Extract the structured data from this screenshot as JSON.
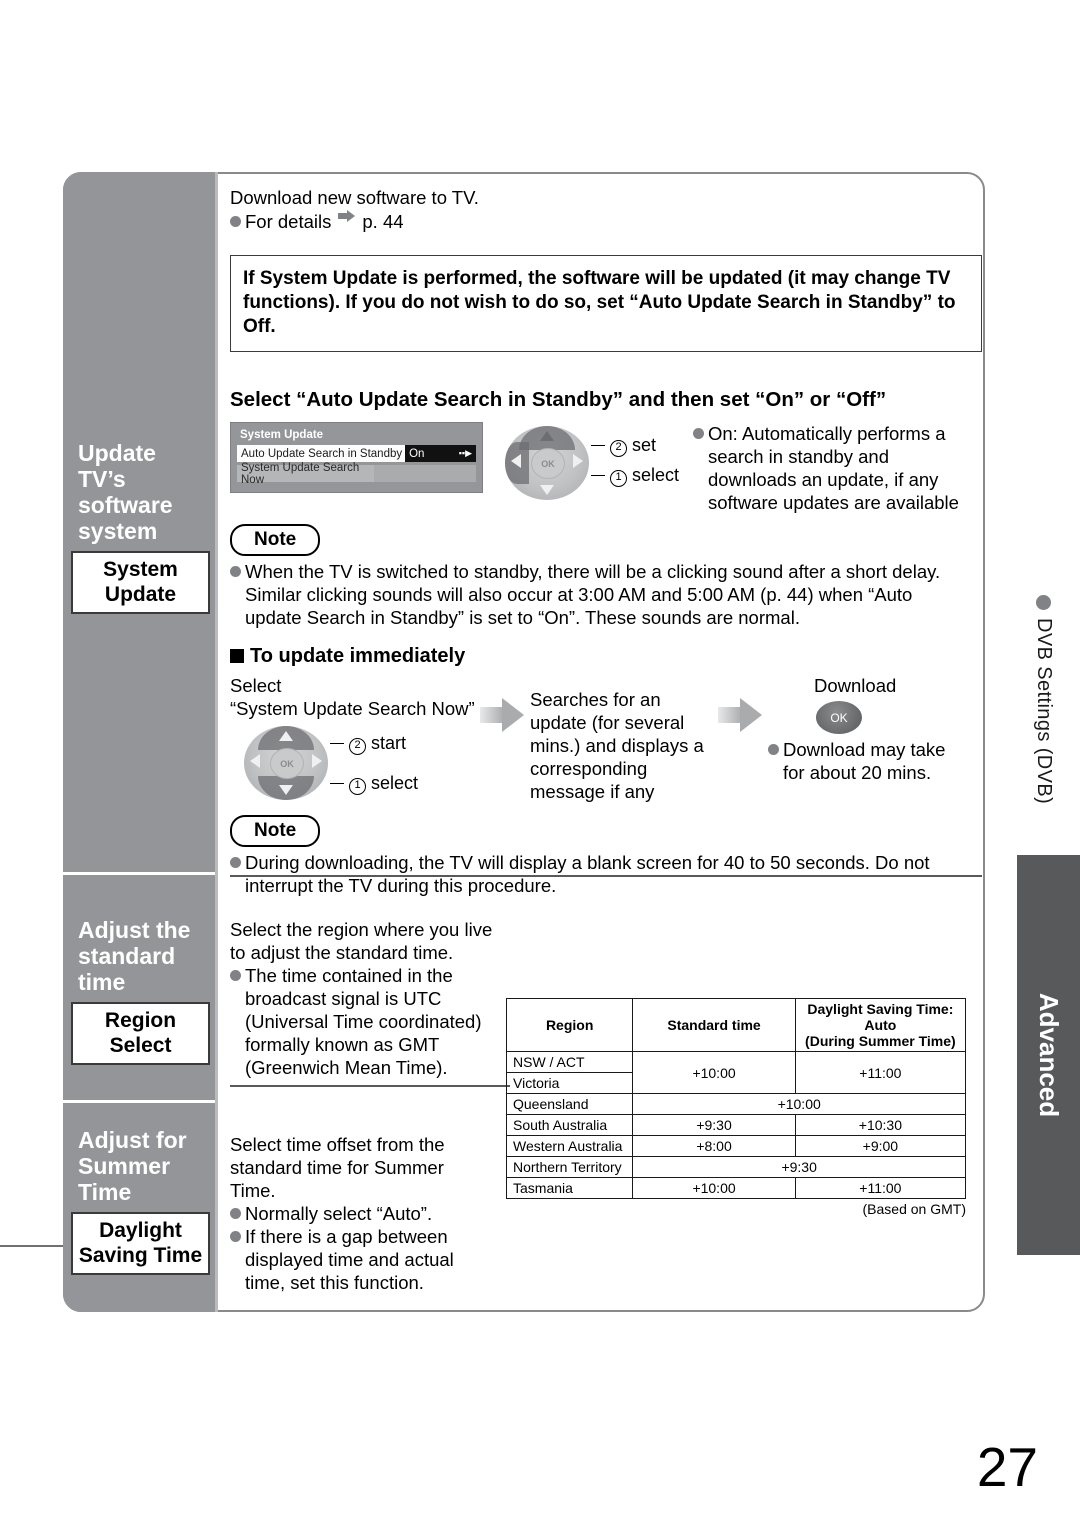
{
  "sidebar": {
    "groups": [
      {
        "heading": "Update\nTV’s\nsoftware\nsystem",
        "heading_line1": "Update",
        "heading_line2": "TV’s",
        "heading_line3": "software",
        "heading_line4": "system",
        "button_line1": "System",
        "button_line2": "Update"
      },
      {
        "heading_line1": "Adjust the",
        "heading_line2": "standard time",
        "button_line1": "Region",
        "button_line2": "Select"
      },
      {
        "heading_line1": "Adjust for",
        "heading_line2": "Summer Time",
        "button_line1": "Daylight",
        "button_line2": "Saving Time"
      }
    ]
  },
  "tabs": {
    "dvb_label": "DVB Settings (DVB)",
    "advanced_label": "Advanced"
  },
  "system_update": {
    "intro_line1": "Download new software to TV.",
    "intro_bullet": "For details",
    "intro_page_ref": "p. 44",
    "warning": "If System Update is performed, the software will be updated (it may change TV functions). If you do not wish to do so, set “Auto Update Search in Standby” to Off.",
    "section_heading": "Select “Auto Update Search in Standby” and then set “On” or “Off”",
    "osd": {
      "title": "System Update",
      "row1_label": "Auto Update Search in Standby",
      "row1_value": "On",
      "row2_label": "System Update Search Now",
      "row2_value": ""
    },
    "dpad1": {
      "step2_num": "②",
      "step2_label": "set",
      "step1_num": "①",
      "step1_label": "select",
      "ok_label": "OK"
    },
    "on_description": "On: Automatically performs a search in standby and downloads an update, if any software updates are available",
    "note1_badge": "Note",
    "note1_text": "When the TV is switched to standby, there will be a clicking sound after a short delay. Similar clicking sounds will also occur at 3:00 AM and 5:00 AM (p. 44) when “Auto update Search in Standby” is set to “On”. These sounds are normal.",
    "immediate_heading": "To update immediately",
    "immediate_select_line1": "Select",
    "immediate_select_line2": "“System Update Search Now”",
    "dpad2": {
      "step2_num": "②",
      "step2_label": "start",
      "step1_num": "①",
      "step1_label": "select",
      "ok_label": "OK"
    },
    "searching_text": "Searches for an update (for several mins.) and displays a corresponding message if any",
    "download_label": "Download",
    "download_ok": "OK",
    "download_note": "Download may take for about 20 mins.",
    "note2_badge": "Note",
    "note2_text": "During downloading, the TV will display a blank screen for 40 to 50 seconds. Do not interrupt the TV during this procedure."
  },
  "region_select": {
    "line1": "Select the region where you live",
    "line2": "to adjust the standard time.",
    "bullet": "The time contained in the broadcast signal is UTC (Universal Time coordinated) formally known as GMT (Greenwich Mean Time)."
  },
  "summer_time": {
    "line1": "Select time offset from the",
    "line2": "standard time for Summer",
    "line3": "Time.",
    "bullet1": "Normally select “Auto”.",
    "bullet2": "If there is a gap between displayed time and actual time, set this function."
  },
  "region_table": {
    "headers": {
      "region": "Region",
      "standard": "Standard time",
      "dst_line1": "Daylight Saving Time: Auto",
      "dst_line2": "(During Summer Time)"
    },
    "rows": [
      {
        "region": "NSW / ACT",
        "standard": "+10:00",
        "dst": "+11:00"
      },
      {
        "region": "Victoria",
        "standard": "+10:00",
        "dst": "+11:00"
      },
      {
        "region": "Queensland",
        "standard": "+10:00",
        "dst": ""
      },
      {
        "region": "South Australia",
        "standard": "+9:30",
        "dst": "+10:30"
      },
      {
        "region": "Western Australia",
        "standard": "+8:00",
        "dst": "+9:00"
      },
      {
        "region": "Northern Territory",
        "standard": "+9:30",
        "dst": ""
      },
      {
        "region": "Tasmania",
        "standard": "+10:00",
        "dst": "+11:00"
      }
    ],
    "footnote": "(Based on GMT)"
  },
  "page_number": "27",
  "colors": {
    "sidebar_gray": "#939598",
    "advanced_tab": "#58595b",
    "bullet_gray": "#808285"
  }
}
